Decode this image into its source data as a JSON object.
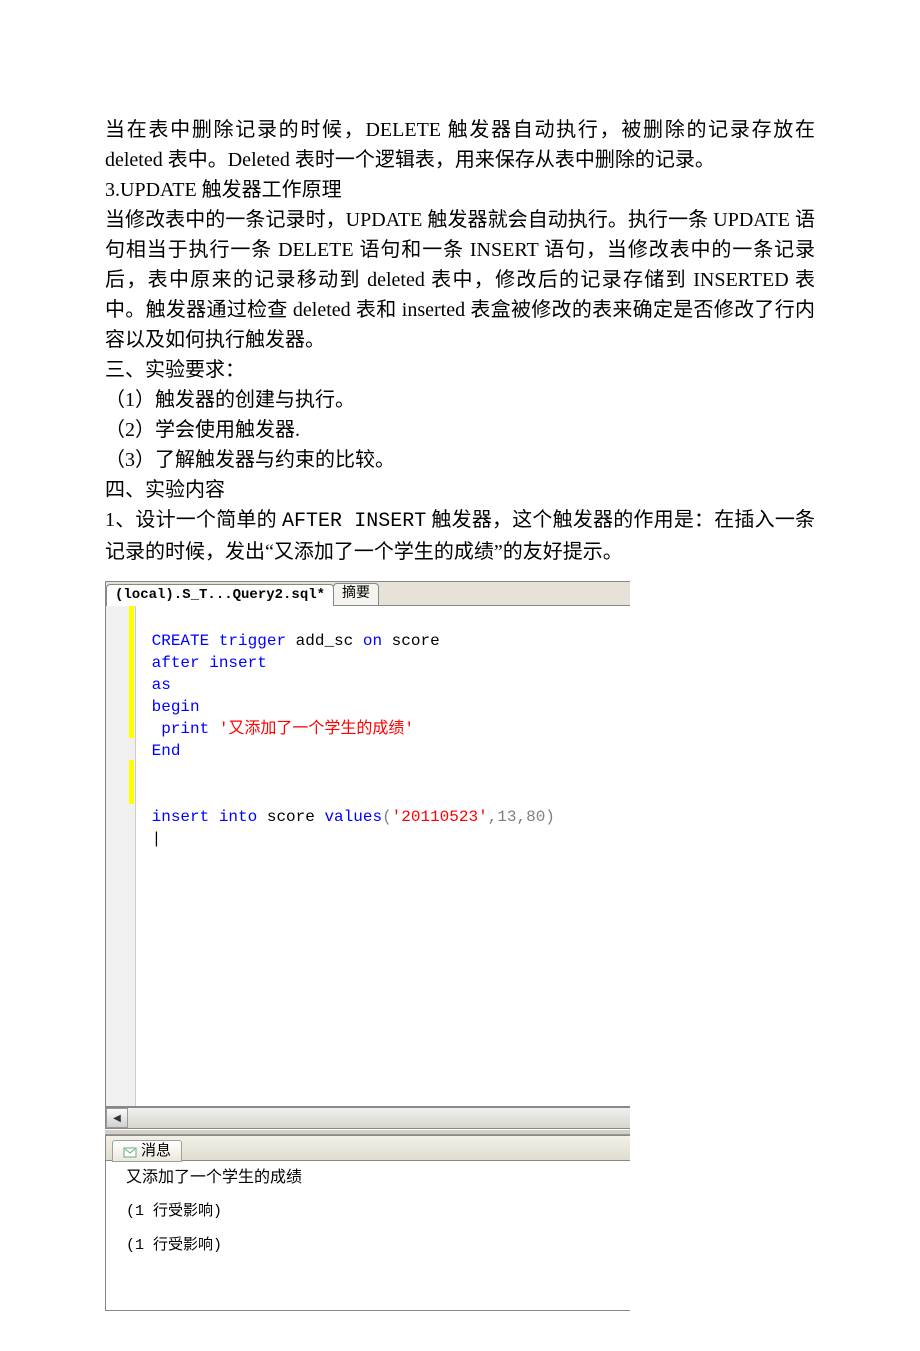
{
  "doc": {
    "p1": "当在表中删除记录的时候，DELETE 触发器自动执行，被删除的记录存放在 deleted 表中。Deleted 表时一个逻辑表，用来保存从表中删除的记录。",
    "p2_title": "3.UPDATE 触发器工作原理",
    "p3": "当修改表中的一条记录时，UPDATE 触发器就会自动执行。执行一条 UPDATE 语句相当于执行一条 DELETE 语句和一条 INSERT 语句，当修改表中的一条记录后，表中原来的记录移动到 deleted 表中，修改后的记录存储到 INSERTED 表中。触发器通过检查 deleted 表和 inserted 表盒被修改的表来确定是否修改了行内容以及如何执行触发器。",
    "p4": "三、实验要求：",
    "p5": "（1）触发器的创建与执行。",
    "p6": "（2）学会使用触发器.",
    "p7": "（3）了解触发器与约束的比较。",
    "p8": "四、实验内容",
    "p9a": "1、设计一个简单的 ",
    "p9b": "AFTER INSERT",
    "p9c": " 触发器，这个触发器的作用是：在插入一条记录的时候，发出“又添加了一个学生的成绩”的友好提示。"
  },
  "tabs": {
    "active": "(local).S_T...Query2.sql*",
    "second": "摘要"
  },
  "code": {
    "line1_kw1": "CREATE",
    "line1_kw2": "trigger",
    "line1_txt": " add_sc ",
    "line1_kw3": "on",
    "line1_txt2": " score",
    "line2": "after",
    "line2b": " insert",
    "line3": "as",
    "line4": "begin",
    "line5_kw": "print",
    "line5_str": "'又添加了一个学生的成绩'",
    "line6": "End",
    "line8_kw1": "insert",
    "line8_kw2": "into",
    "line8_txt": " score ",
    "line8_kw3": "values",
    "line8_paren1": "(",
    "line8_str": "'20110523'",
    "line8_rest": ",13,80",
    "line8_paren2": ")"
  },
  "messages": {
    "tab_label": "消息",
    "row1": "又添加了一个学生的成绩",
    "row2": "(1 行受影响)",
    "row3": "(1 行受影响)"
  }
}
